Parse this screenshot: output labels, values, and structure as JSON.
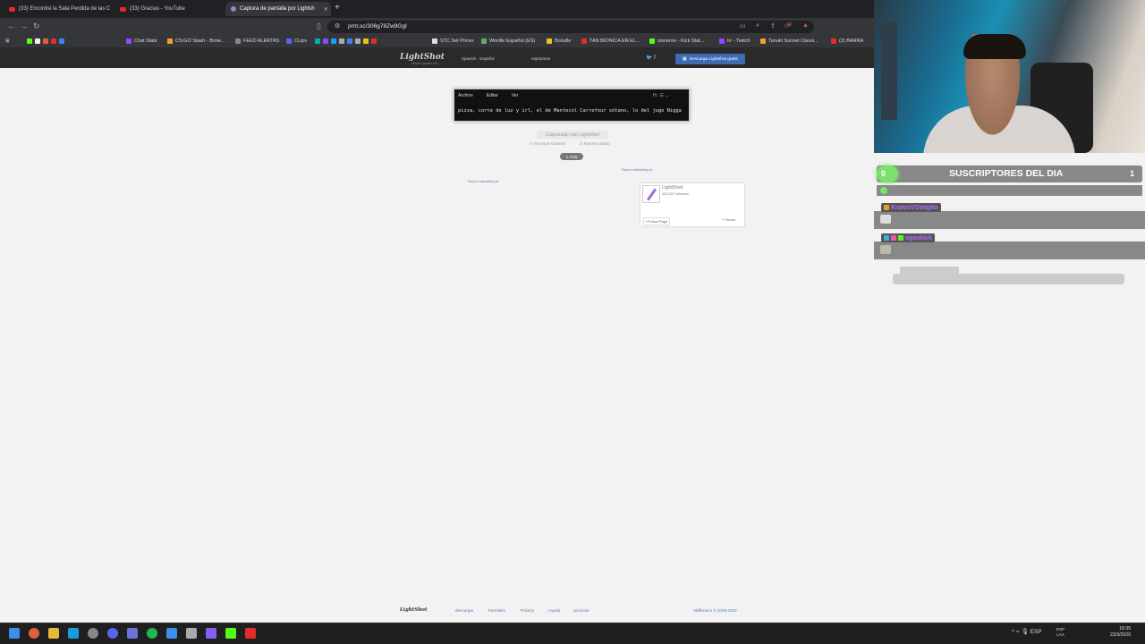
{
  "browser": {
    "tabs": [
      {
        "label": "(33) Encontré la Sala Perdida de las C",
        "icon": "youtube-icon"
      },
      {
        "label": "(33) Gracias - YouTube",
        "icon": "youtube-icon"
      },
      {
        "label": "Captura de pantalla por Lightsh",
        "icon": "lightshot-icon",
        "active": true
      }
    ],
    "new_tab": "+",
    "url": "prnt.sc/306g78Zw9GgI",
    "bookmarks": [
      {
        "label": "Chat Stats",
        "color": "#9146ff"
      },
      {
        "label": "CS:GO Stash - Brow...",
        "color": "#f0a030"
      },
      {
        "label": "FEED ALERTAS",
        "color": "#888888"
      },
      {
        "label": "CLips",
        "color": "#5865f2"
      },
      {
        "label": "STC Set Prices",
        "color": "#e0e0e0"
      },
      {
        "label": "Wordle Español (ES)",
        "color": "#6aaa64"
      },
      {
        "label": "Boludle",
        "color": "#f0c020"
      },
      {
        "label": "TAN BIONICA EN EL...",
        "color": "#e52d27"
      },
      {
        "label": "sioneron - Kick Stat...",
        "color": "#53fc18"
      },
      {
        "label": "trr - Twitch",
        "color": "#9146ff"
      },
      {
        "label": "Tanuki Sunset Classi...",
        "color": "#f0a030"
      },
      {
        "label": "(2) BARRA",
        "color": "#e52d27"
      }
    ]
  },
  "lightshot": {
    "logo": "LightShot",
    "logo_sub": "simple capture tool",
    "language": "Spanish - Español",
    "sign_in": "registrarse",
    "social": "🐦 f",
    "download_button": "Descarga Lightshot gratis",
    "screenshot": {
      "menu": [
        "Archivo",
        "Editar",
        "Ver"
      ],
      "controls": "H↕  ☰ ⌄",
      "text": "pizza, corte de luz y irl, el de Mantecol Carrefour sótano, lo del jugo Nigga"
    },
    "captured_label": "Capturado con Lightshot",
    "find_similar": "⊙ encontrar similares",
    "report": "⊡ Reportar abuso",
    "post_button": "𝕏 Post",
    "report_ad_1": "Report misleading ad",
    "report_ad_2": "Report misleading ad",
    "facebook": {
      "name": "LightShot",
      "followers": "322,837 followers",
      "follow": "f Follow Page",
      "share": "↪ Share"
    },
    "footer": {
      "logo": "LightShot",
      "links": [
        "descargar",
        "Tutoriales",
        "Privacy",
        "¡Ayuda",
        "anunciar"
      ],
      "copyright": "Skillbrains © 2009-2022"
    }
  },
  "overlay": {
    "subs_count": "0",
    "subs_title": "SUSCRIPTORES DEL DIA",
    "subs_goal": "1",
    "subs_progress": 0,
    "chat": [
      {
        "name": "KratosVSVegito",
        "color": "#b46bff"
      },
      {
        "name": "ogaskick",
        "color": "#b46bff"
      }
    ]
  },
  "taskbar": {
    "tray": "^  ⌁  🎙  ESP",
    "lang_top": "ESP",
    "lang_bottom": "LAA",
    "time": "18:35",
    "date": "23/3/2026"
  }
}
